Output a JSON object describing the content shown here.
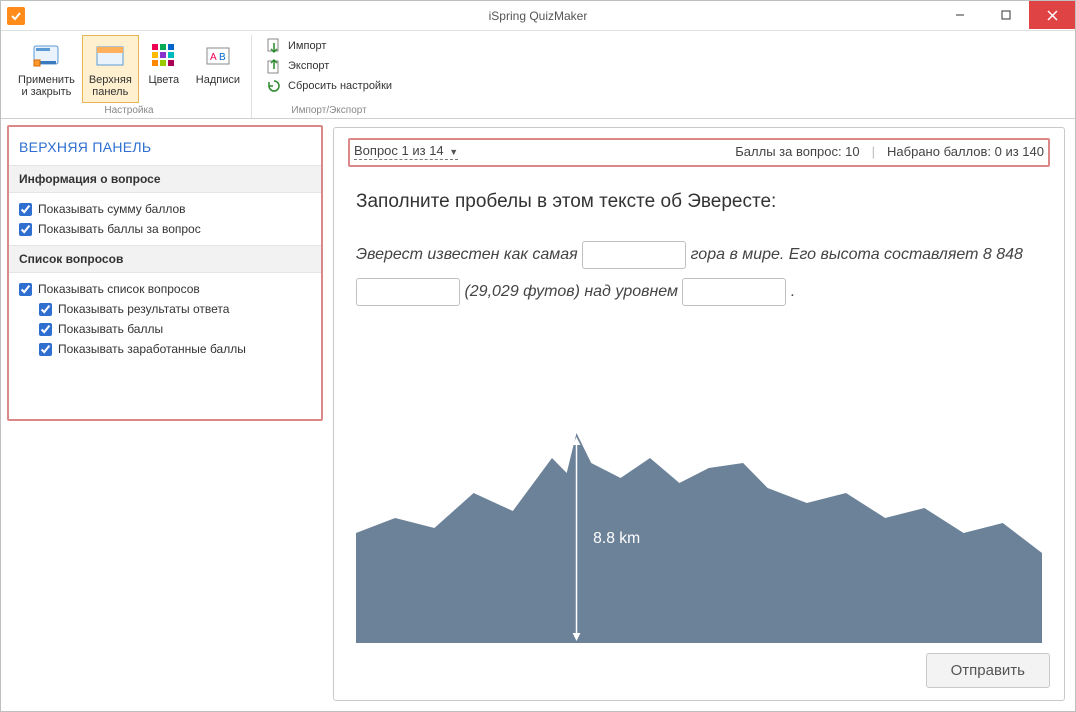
{
  "window": {
    "title": "iSpring QuizMaker"
  },
  "ribbon": {
    "group1_label": "Настройка",
    "group2_label": "Импорт/Экспорт",
    "apply_close": "Применить\nи закрыть",
    "top_panel": "Верхняя\nпанель",
    "colors": "Цвета",
    "labels": "Надписи",
    "import": "Импорт",
    "export": "Экспорт",
    "reset": "Сбросить настройки"
  },
  "sidebar": {
    "title": "ВЕРХНЯЯ ПАНЕЛЬ",
    "section_info": "Информация о вопросе",
    "show_total_points": "Показывать сумму баллов",
    "show_question_points": "Показывать баллы за вопрос",
    "section_list": "Список вопросов",
    "show_question_list": "Показывать список вопросов",
    "show_answer_results": "Показывать результаты ответа",
    "show_points": "Показывать баллы",
    "show_earned_points": "Показывать заработанные баллы"
  },
  "preview": {
    "question_selector": "Вопрос 1 из 14",
    "points_label": "Баллы за вопрос: 10",
    "score_label": "Набрано баллов: 0 из 140",
    "question_title": "Заполните пробелы в этом тексте об Эвересте:",
    "text1": "Эверест известен как самая ",
    "text2": " гора в мире. Его высота составляет 8 848 ",
    "text3": " (29,029 футов) над уровнем ",
    "text4": " .",
    "mountain_label": "8.8 km",
    "submit": "Отправить"
  }
}
